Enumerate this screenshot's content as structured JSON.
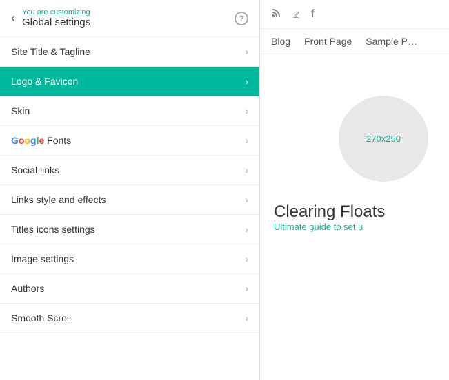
{
  "header": {
    "customizing_label": "You are customizing",
    "settings_label": "Global settings",
    "help_label": "?"
  },
  "menu": {
    "items": [
      {
        "id": "site-title",
        "label": "Site Title & Tagline",
        "active": false
      },
      {
        "id": "logo-favicon",
        "label": "Logo & Favicon",
        "active": true
      },
      {
        "id": "skin",
        "label": "Skin",
        "active": false
      },
      {
        "id": "google-fonts",
        "label": "Google Fonts",
        "active": false,
        "special": true
      },
      {
        "id": "social-links",
        "label": "Social links",
        "active": false
      },
      {
        "id": "links-style",
        "label": "Links style and effects",
        "active": false
      },
      {
        "id": "titles-icons",
        "label": "Titles icons settings",
        "active": false
      },
      {
        "id": "image-settings",
        "label": "Image settings",
        "active": false
      },
      {
        "id": "authors",
        "label": "Authors",
        "active": false
      },
      {
        "id": "smooth-scroll",
        "label": "Smooth Scroll",
        "active": false
      }
    ]
  },
  "right_panel": {
    "social_icons": [
      "rss",
      "twitter",
      "facebook"
    ],
    "nav_links": [
      "Blog",
      "Front Page",
      "Sample P"
    ],
    "placeholder": "270x250",
    "article_title": "Clearing Floats",
    "article_subtitle": "Ultimate guide to set u"
  },
  "icons": {
    "back": "‹",
    "chevron": "›",
    "rss": "⊞",
    "twitter": "🐦",
    "facebook": "f"
  }
}
